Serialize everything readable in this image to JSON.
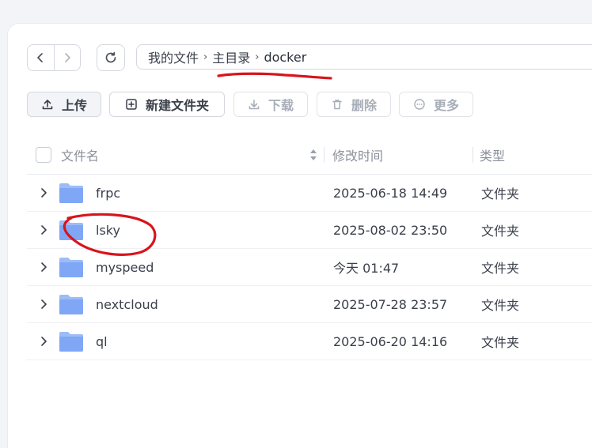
{
  "breadcrumb": {
    "items": [
      "我的文件",
      "主目录",
      "docker"
    ]
  },
  "toolbar": {
    "upload": "上传",
    "new_folder": "新建文件夹",
    "download": "下载",
    "delete": "删除",
    "more": "更多"
  },
  "table": {
    "columns": {
      "name": "文件名",
      "modified": "修改时间",
      "type": "类型"
    },
    "rows": [
      {
        "name": "frpc",
        "modified": "2025-06-18 14:49",
        "type": "文件夹"
      },
      {
        "name": "lsky",
        "modified": "2025-08-02 23:50",
        "type": "文件夹"
      },
      {
        "name": "myspeed",
        "modified": "今天 01:47",
        "type": "文件夹"
      },
      {
        "name": "nextcloud",
        "modified": "2025-07-28 23:57",
        "type": "文件夹"
      },
      {
        "name": "ql",
        "modified": "2025-06-20 14:16",
        "type": "文件夹"
      }
    ]
  },
  "icons": {
    "back": "chevron-left-icon",
    "forward": "chevron-right-icon",
    "refresh": "refresh-icon",
    "folder": "folder-icon",
    "expand": "chevron-right-icon"
  },
  "colors": {
    "folder": "#7fa7f5",
    "annotation": "#d8141c"
  }
}
